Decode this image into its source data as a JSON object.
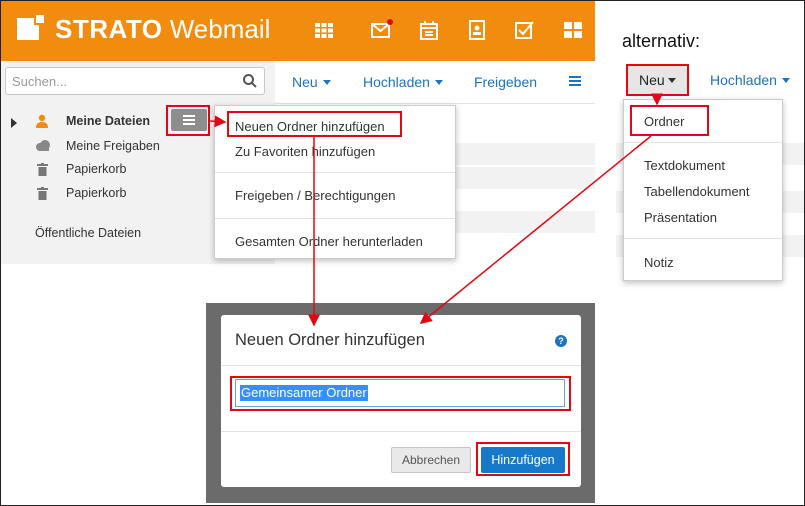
{
  "header": {
    "brand_bold": "STRATO",
    "brand_light": "Webmail",
    "icons": [
      "grid-icon",
      "mail-icon",
      "calendar-icon",
      "contacts-icon",
      "tasks-icon",
      "apps-icon"
    ],
    "brand_color": "#f28c0f"
  },
  "sidebar": {
    "search_placeholder": "Suchen...",
    "items": [
      {
        "label": "Meine Dateien"
      },
      {
        "label": "Meine Freigaben"
      },
      {
        "label": "Papierkorb"
      },
      {
        "label": "Papierkorb"
      }
    ],
    "public_files": "Öffentliche Dateien"
  },
  "toolbar": {
    "neu": "Neu",
    "hochladen": "Hochladen",
    "freigeben": "Freigeben"
  },
  "context_menu": {
    "items": [
      "Neuen Ordner hinzufügen",
      "Zu Favoriten hinzufügen",
      "Freigeben / Berechtigungen",
      "Gesamten Ordner herunterladen"
    ]
  },
  "alternative": {
    "label": "alternativ:",
    "neu": "Neu",
    "hochladen": "Hochladen",
    "menu": {
      "ordner": "Ordner",
      "textdokument": "Textdokument",
      "tabellendokument": "Tabellendokument",
      "praesentation": "Präsentation",
      "notiz": "Notiz"
    }
  },
  "dialog": {
    "title": "Neuen Ordner hinzufügen",
    "input_value": "Gemeinsamer Ordner",
    "cancel": "Abbrechen",
    "submit": "Hinzufügen",
    "accent_color": "#1679c9"
  },
  "annotation_color": "#e30613"
}
